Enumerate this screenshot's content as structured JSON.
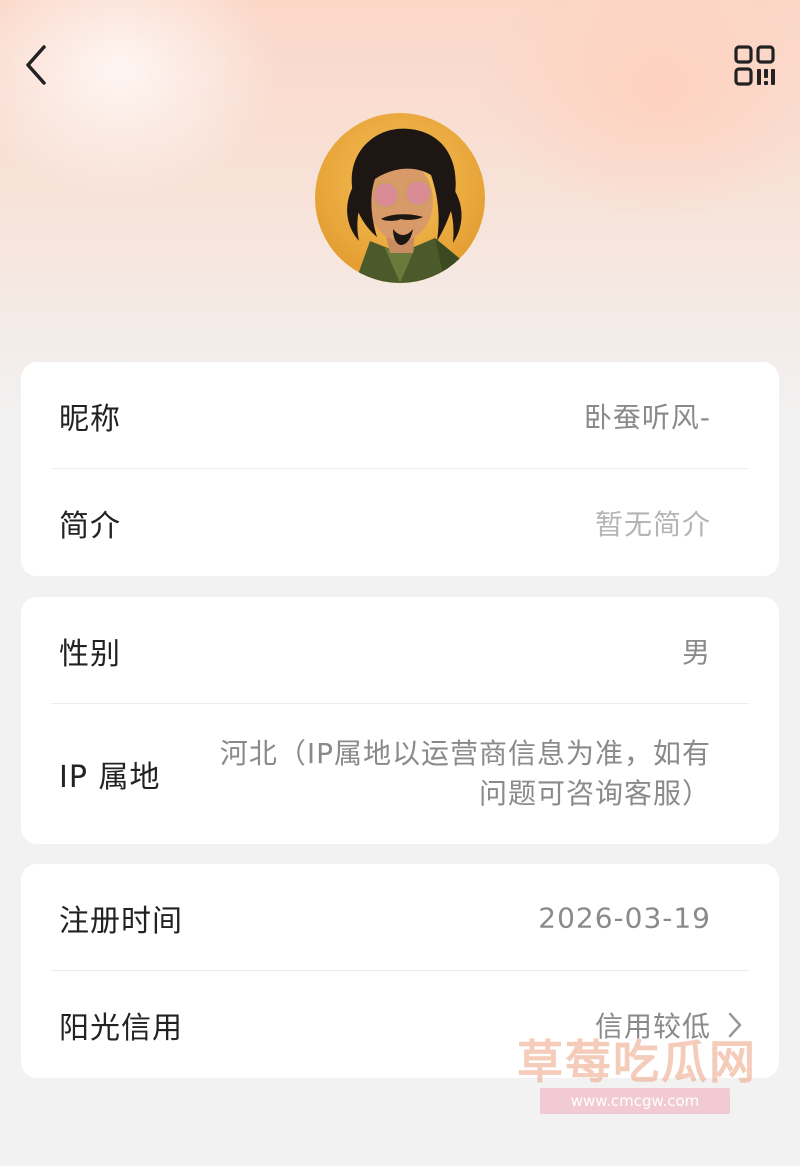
{
  "header": {
    "back_icon": "chevron-left-icon",
    "qr_icon": "qr-code-icon"
  },
  "profile": {
    "avatar": "avatar-image"
  },
  "sections": [
    {
      "rows": [
        {
          "label": "昵称",
          "value": "卧蚕听风-"
        },
        {
          "label": "简介",
          "value": "暂无简介"
        }
      ]
    },
    {
      "rows": [
        {
          "label": "性别",
          "value": "男"
        },
        {
          "label": "IP 属地",
          "value": "河北（IP属地以运营商信息为准，如有问题可咨询客服）"
        }
      ]
    },
    {
      "rows": [
        {
          "label": "注册时间",
          "value": "2026-03-19"
        },
        {
          "label": "阳光信用",
          "value": "信用较低",
          "icon": "chevron-right-icon"
        }
      ]
    }
  ],
  "watermark": {
    "title": "草莓吃瓜网",
    "url": "www.cmcgw.com"
  },
  "colors": {
    "card_bg": "#ffffff",
    "page_bg": "#f2f2f2",
    "label": "#222222",
    "value": "#8a8a8a",
    "placeholder": "#b5b5b5"
  }
}
